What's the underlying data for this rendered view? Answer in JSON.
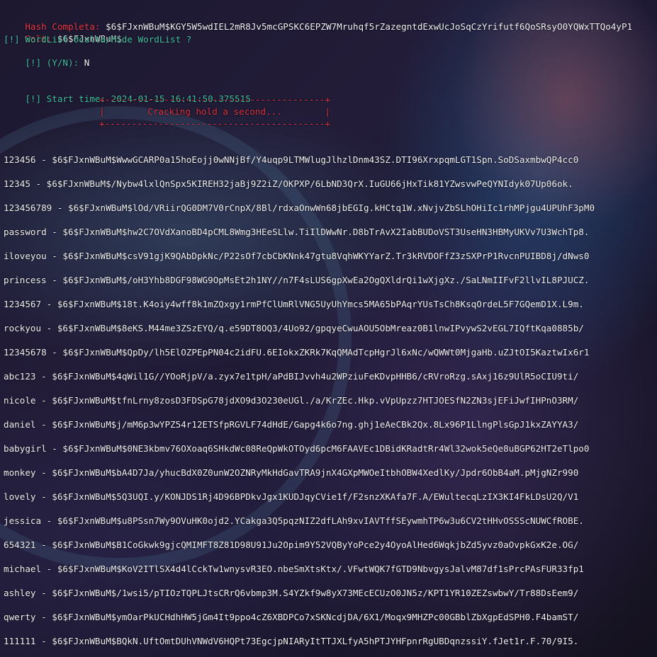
{
  "header": {
    "hash_label": "Hash Completa:",
    "hash_value": "$6$FJxnWBuM$KGY5W5wdIEL2mR8Jv5mcGPSKC6EPZW7Mruhqf5rZazegntdExwUcJoSqCzYrifutf6QoSRsyO0YQWxTTQo4yP1",
    "salt_label": "Salt:",
    "salt_value": "$6$FJxnWBuM$",
    "wordlist_prompt": "[!] WordList Oculta/Hide WordList ?",
    "yn_prompt": "[!] (Y/N):",
    "yn_answer": "N",
    "start_time_label": "[!] Start time:",
    "start_time_value": "2024-01-15 16:41:50.375515"
  },
  "banner": {
    "top_border": "+-----------------------------------------+",
    "message": "|        Cracking hold a second...        |",
    "bottom_border": "+-----------------------------------------+"
  },
  "results": [
    {
      "word": "123456",
      "hash": "$6$FJxnWBuM$WwwGCARP0a15hoEojj0wNNjBf/Y4uqp9LTMWlugJlhzlDnm43SZ.DTI96XrxpqmLGT1Spn.SoDSaxmbwQP4cc0"
    },
    {
      "word": "12345",
      "hash": "$6$FJxnWBuM$/Nybw4lxlQnSpx5KIREH32jaBj9Z2iZ/OKPXP/6LbND3QrX.IuGU66jHxTik81YZwsvwPeQYNIdyk07Up06ok."
    },
    {
      "word": "123456789",
      "hash": "$6$FJxnWBuM$lOd/VRiirQG0DM7V0rCnpX/8Bl/rdxaOnwWn68jbEGIg.kHCtq1W.xNvjvZbSLhOHiIc1rhMPjgu4UPUhF3pM0"
    },
    {
      "word": "password",
      "hash": "$6$FJxnWBuM$hw2C7OVdXanoBD4pCML8Wmg3HEeSLlw.TiIlDWwNr.D8bTrAvX2IabBUDoVST3UseHN3HBMyUKVv7U3WchTp8."
    },
    {
      "word": "iloveyou",
      "hash": "$6$FJxnWBuM$csV91gjK9QAbDpkNc/P22sOf7cbCbKNnk47gtu8VqhWKYYarZ.Tr3kRVDOFfZ3zSXPrP1RvcnPUIBD8j/dNws0"
    },
    {
      "word": "princess",
      "hash": "$6$FJxnWBuM$/oH3Yhb8DGF98WG9OpMsEt2h1NY//n7F4sLUS6gpXwEa2OgQXldrQi1wXjgXz./SaLNmIIFvF2llvIL8PJUCZ."
    },
    {
      "word": "1234567",
      "hash": "$6$FJxnWBuM$18t.K4oiy4wff8k1mZQxgy1rmPfClUmRlVNG5UyUhYmcs5MA65bPAqrYUsTsCh8KsqOrdeL5F7GQemD1X.L9m."
    },
    {
      "word": "rockyou",
      "hash": "$6$FJxnWBuM$8eKS.M44me3ZSzEYQ/q.e59DT8OQ3/4Uo92/gpqyeCwuAOU5ObMreaz0B1lnwIPvywS2vEGL7IQftKqa0885b/"
    },
    {
      "word": "12345678",
      "hash": "$6$FJxnWBuM$QpDy/lh5ElOZPEpPN04c2idFU.6EIokxZKRk7KqQMAdTcpHgrJl6xNc/wQWWt0MjgaHb.uZJtOI5KaztwIx6r1"
    },
    {
      "word": "abc123",
      "hash": "$6$FJxnWBuM$4qWil1G//YOoRjpV/a.zyx7e1tpH/aPdBIJvvh4u2WPziuFeKDvpHHB6/cRVroRzg.sAxj16z9UlR5oCIU9ti/"
    },
    {
      "word": "nicole",
      "hash": "$6$FJxnWBuM$tfnLrny8zosD3FDSpG78jdXO9d3O230eUGl./a/KrZEc.Hkp.vVpUpzz7HTJOESfN2ZN3sjEFiJwfIHPnO3RM/"
    },
    {
      "word": "daniel",
      "hash": "$6$FJxnWBuM$j/mM6p3wYPZ54r12ETSfpRGVLF74dHdE/Gapg4k6o7ng.ghj1eAeCBk2Qx.8Lx96P1LlngPlsGpJ1kxZAYYA3/"
    },
    {
      "word": "babygirl",
      "hash": "$6$FJxnWBuM$0NE3kbmv76OXoaq6SHkdWc08ReQpWkOTOyd6pcM6FAAVEc1DBidKRadtRr4Wl32wok5eQe8uBGP62HT2eTlpo0"
    },
    {
      "word": "monkey",
      "hash": "$6$FJxnWBuM$bA4D7Ja/yhucBdX0Z0unW2OZNRyMkHdGavTRA9jnX4GXpMWOeItbhOBW4XedlKy/Jpdr6ObB4aM.pMjgNZr990"
    },
    {
      "word": "lovely",
      "hash": "$6$FJxnWBuM$5Q3UQI.y/KONJDS1Rj4D96BPDkvJgx1KUDJqyCVie1f/F2snzXKAfa7F.A/EWultecqLzIX3KI4FkLDsU2Q/V1"
    },
    {
      "word": "jessica",
      "hash": "$6$FJxnWBuM$u8PSsn7Wy9OVuHK0ojd2.YCakga3Q5pqzNIZ2dfLAh9xvIAVTffSEywmhTP6w3u6CV2tHHvOSSScNUWCfROBE."
    },
    {
      "word": "654321",
      "hash": "$6$FJxnWBuM$B1CoGkwk9gjcQMIMFT8Z81D98U91Ju2Opim9Y52VQByYoPce2y4OyoAlHed6WqkjbZd5yvz0aOvpkGxK2e.OG/"
    },
    {
      "word": "michael",
      "hash": "$6$FJxnWBuM$KoV2ITlSX4d4lCckTw1wnysvR3EO.nbeSmXtsKtx/.VFwtWQK7fGTD9NbvgysJalvM87df1sPrcPAsFUR33fp1"
    },
    {
      "word": "ashley",
      "hash": "$6$FJxnWBuM$/1wsi5/pTIOzTQPLJtsCRrQ6vbmp3M.S4YZkf9w8yX73MEcECUzO0JN5z/KPT1YR10ZEZswbwY/Tr88DsEem9/"
    },
    {
      "word": "qwerty",
      "hash": "$6$FJxnWBuM$ymOarPkUCHdhHW5jGm4It9ppo4cZ6XBDPCo7xSKNcdjDA/6X1/Moqx9MHZPc00GBblZbXgpEdSPH0.F4bamST/"
    },
    {
      "word": "111111",
      "hash": "$6$FJxnWBuM$BQkN.UftOmtDUhVNWdV6HQPt73EgcjpNIARyItTTJXLfyA5hPTJYHFpnrRgUBDqnzssiY.fJet1r.F.70/9I5."
    }
  ],
  "separator": " - ",
  "colors": {
    "label_red": "#e8394a",
    "prompt_green": "#3fc0a0",
    "text_white": "#f0f0f4"
  }
}
